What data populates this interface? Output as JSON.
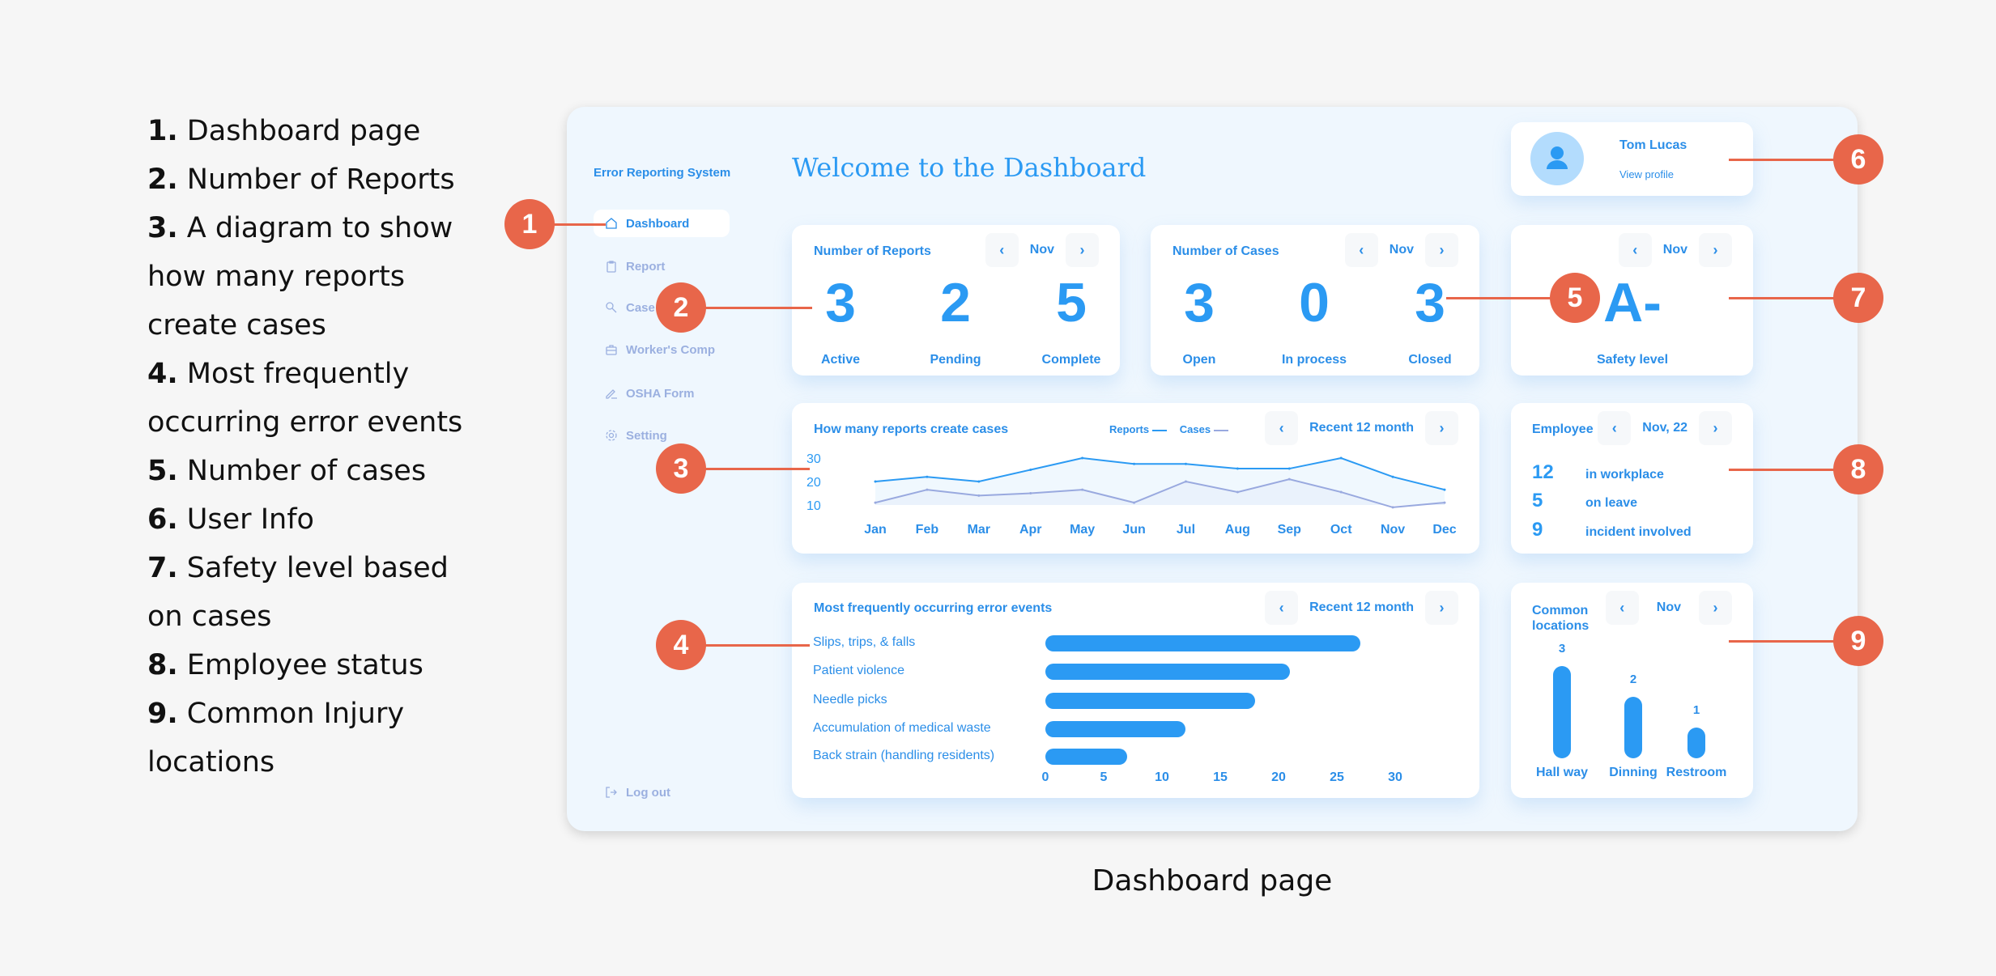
{
  "annotations": [
    {
      "num": "1.",
      "text": "Dashboard page"
    },
    {
      "num": "2.",
      "text": "Number of Reports"
    },
    {
      "num": "3.",
      "text": "A diagram to show how many reports create cases"
    },
    {
      "num": "4.",
      "text": "Most frequently occurring error events"
    },
    {
      "num": "5.",
      "text": "Number of cases"
    },
    {
      "num": "6.",
      "text": "User Info"
    },
    {
      "num": "7.",
      "text": "Safety level based on cases"
    },
    {
      "num": "8.",
      "text": "Employee status"
    },
    {
      "num": "9.",
      "text": "Common Injury locations"
    }
  ],
  "markers": [
    "1",
    "2",
    "3",
    "4",
    "5",
    "6",
    "7",
    "8",
    "9"
  ],
  "caption": "Dashboard page",
  "sidebar": {
    "title": "Error Reporting System",
    "items": [
      {
        "label": "Dashboard",
        "icon": "home-icon"
      },
      {
        "label": "Report",
        "icon": "clipboard-icon"
      },
      {
        "label": "Case",
        "icon": "search-icon"
      },
      {
        "label": "Worker's Comp",
        "icon": "briefcase-icon"
      },
      {
        "label": "OSHA Form",
        "icon": "pencil-icon"
      },
      {
        "label": "Setting",
        "icon": "gear-icon"
      }
    ],
    "logout": "Log out"
  },
  "welcome": "Welcome to the Dashboard",
  "user": {
    "name": "Tom Lucas",
    "link": "View profile"
  },
  "reports": {
    "title": "Number of Reports",
    "period": "Nov",
    "stats": [
      {
        "value": "3",
        "label": "Active"
      },
      {
        "value": "2",
        "label": "Pending"
      },
      {
        "value": "5",
        "label": "Complete"
      }
    ]
  },
  "cases": {
    "title": "Number of Cases",
    "period": "Nov",
    "stats": [
      {
        "value": "3",
        "label": "Open"
      },
      {
        "value": "0",
        "label": "In process"
      },
      {
        "value": "3",
        "label": "Closed"
      }
    ]
  },
  "safety": {
    "period": "Nov",
    "grade": "A-",
    "label": "Safety level"
  },
  "employee": {
    "title": "Employee",
    "period": "Nov, 22",
    "rows": [
      {
        "value": "12",
        "label": "in workplace"
      },
      {
        "value": "5",
        "label": "on leave"
      },
      {
        "value": "9",
        "label": "incident involved"
      }
    ]
  },
  "pager": {
    "prev": "‹",
    "next": "›"
  },
  "chart_data": [
    {
      "type": "line",
      "title": "How many reports create cases",
      "period": "Recent 12 month",
      "categories": [
        "Jan",
        "Feb",
        "Mar",
        "Apr",
        "May",
        "Jun",
        "Jul",
        "Aug",
        "Sep",
        "Oct",
        "Nov",
        "Dec"
      ],
      "yticks": [
        "30",
        "20",
        "10"
      ],
      "ylim": [
        10,
        30
      ],
      "series": [
        {
          "name": "Reports",
          "color": "#2b9af3",
          "values": [
            20,
            22,
            20,
            25,
            30,
            27.5,
            27.5,
            25.5,
            25.5,
            30,
            22,
            16.5
          ]
        },
        {
          "name": "Cases",
          "color": "#99a9df",
          "values": [
            11,
            16.5,
            14,
            15,
            16.5,
            11,
            20,
            15.5,
            21,
            15.5,
            9,
            11
          ]
        }
      ]
    },
    {
      "type": "bar",
      "title": "Most frequently occurring error events",
      "period": "Recent 12 month",
      "categories": [
        "Slips, trips, & falls",
        "Patient violence",
        "Needle picks",
        "Accumulation of medical waste",
        "Back strain (handling residents)"
      ],
      "values": [
        27,
        21,
        18,
        12,
        7
      ],
      "xticks": [
        "0",
        "5",
        "10",
        "15",
        "20",
        "25",
        "30"
      ],
      "xlim": [
        0,
        30
      ]
    },
    {
      "type": "bar",
      "title": "Common locations",
      "period": "Nov",
      "categories": [
        "Hall way",
        "Dinning",
        "Restroom"
      ],
      "values": [
        3,
        2,
        1
      ],
      "labels": [
        "3",
        "2",
        "1"
      ]
    }
  ]
}
